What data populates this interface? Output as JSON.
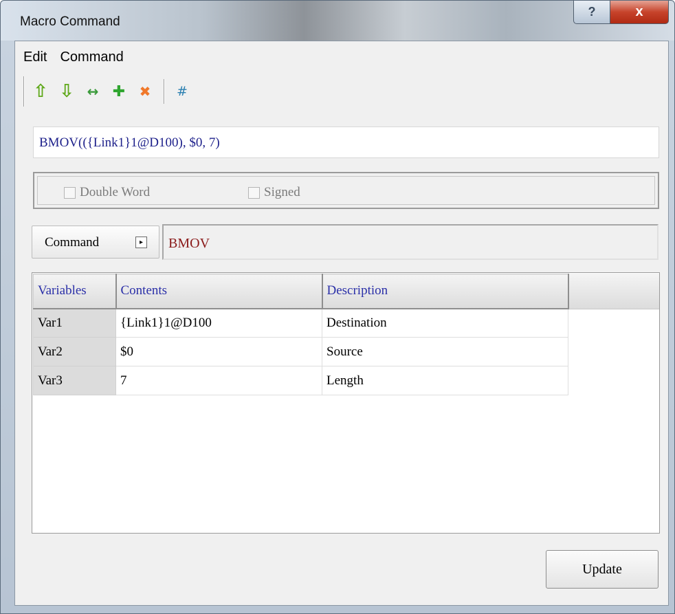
{
  "window": {
    "title": "Macro Command",
    "help_glyph": "?",
    "close_glyph": "x"
  },
  "menu": {
    "items": [
      "Edit",
      "Command"
    ]
  },
  "toolbar": {
    "icons": [
      {
        "name": "move-up-icon",
        "glyph": "⇧",
        "color": "#5fa81a"
      },
      {
        "name": "move-down-icon",
        "glyph": "⇩",
        "color": "#5fa81a"
      },
      {
        "name": "replace-icon",
        "glyph": "↔",
        "color": "#3a9a3a"
      },
      {
        "name": "add-icon",
        "glyph": "✚",
        "color": "#2fa52f"
      },
      {
        "name": "delete-icon",
        "glyph": "✖",
        "color": "#f0782a"
      }
    ],
    "hash_glyph": "#",
    "hash_color": "#2a7fb0"
  },
  "expression": {
    "value": "BMOV(({Link1}1@D100), $0, 7)"
  },
  "options": {
    "double_word": {
      "label": "Double Word",
      "checked": false
    },
    "signed": {
      "label": "Signed",
      "checked": false
    }
  },
  "command": {
    "button_label": "Command",
    "arrow_glyph": "▸",
    "current": "BMOV"
  },
  "table": {
    "headers": [
      "Variables",
      "Contents",
      "Description"
    ],
    "rows": [
      [
        "Var1",
        "{Link1}1@D100",
        "Destination"
      ],
      [
        "Var2",
        "$0",
        "Source"
      ],
      [
        "Var3",
        "7",
        "Length"
      ]
    ]
  },
  "footer": {
    "update_label": "Update"
  }
}
